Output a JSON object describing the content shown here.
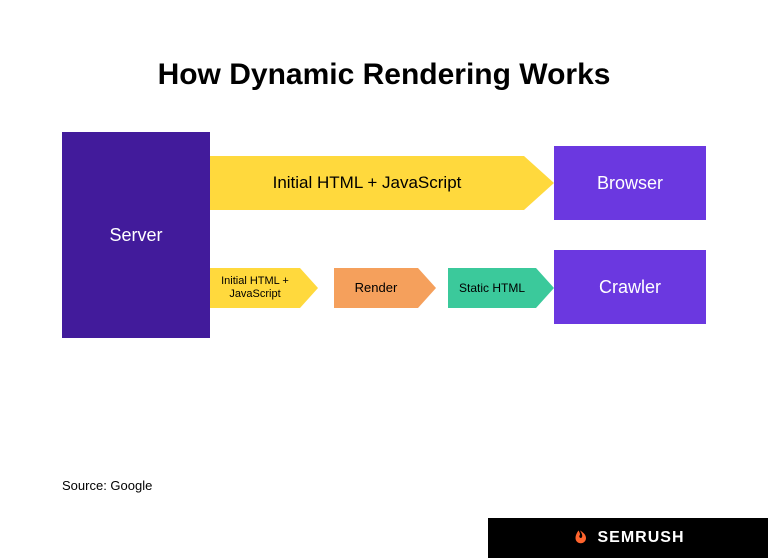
{
  "title": "How Dynamic Rendering Works",
  "server_label": "Server",
  "browser_label": "Browser",
  "crawler_label": "Crawler",
  "arrow_top_label": "Initial HTML + JavaScript",
  "arrow_b1_label": "Initial HTML + JavaScript",
  "arrow_b2_label": "Render",
  "arrow_b3_label": "Static HTML",
  "source": "Source: Google",
  "brand": "SEMRUSH",
  "colors": {
    "server": "#421b9b",
    "endpoint": "#6b38e0",
    "yellow": "#ffd93d",
    "orange": "#f5a05c",
    "green": "#3bc99b"
  }
}
